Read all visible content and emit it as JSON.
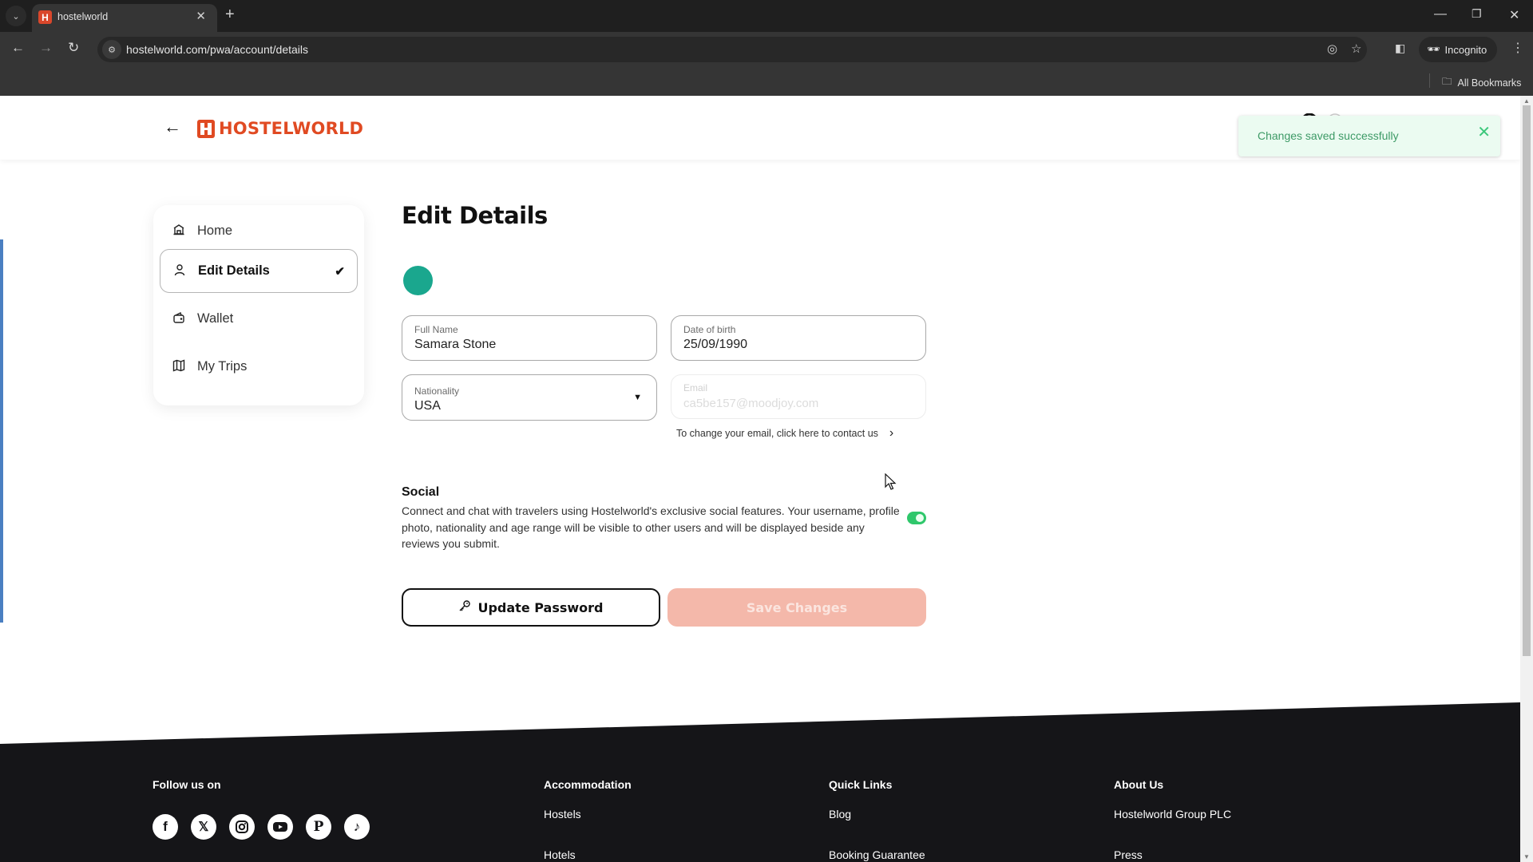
{
  "browser": {
    "tab_title": "hostelworld",
    "url": "hostelworld.com/pwa/account/details",
    "profile_label": "Incognito",
    "bookmarks_label": "All Bookmarks",
    "icons": {
      "tab_list": "chevron-down",
      "favicon": "H",
      "tab_close": "✕",
      "new_tab": "+",
      "back": "←",
      "forward": "→",
      "reload": "↻",
      "minimize": "—",
      "restore": "❐",
      "close": "✕"
    }
  },
  "header": {
    "back_icon": "←",
    "logo_text": "HOSTELWORLD"
  },
  "toast": {
    "message": "Changes saved successfully",
    "close_icon": "✕"
  },
  "sidebar": {
    "items": [
      {
        "label": "Home",
        "icon": "home-icon",
        "active": false
      },
      {
        "label": "Edit Details",
        "icon": "user-icon",
        "active": true
      },
      {
        "label": "Wallet",
        "icon": "wallet-icon",
        "active": false
      },
      {
        "label": "My Trips",
        "icon": "map-icon",
        "active": false
      }
    ],
    "check_icon": "✔"
  },
  "main": {
    "title": "Edit Details",
    "avatar_color": "#1aa78e",
    "fields": {
      "full_name": {
        "label": "Full Name",
        "value": "Samara Stone"
      },
      "dob": {
        "label": "Date of birth",
        "value": "25/09/1990"
      },
      "nationality": {
        "label": "Nationality",
        "value": "USA"
      },
      "email": {
        "label": "Email",
        "value": "ca5be157@moodjoy.com",
        "disabled": true
      }
    },
    "contact_text": "To change your email, click here to contact us",
    "social": {
      "title": "Social",
      "description": "Connect and chat with travelers using Hostelworld's exclusive social features. Your username, profile photo, nationality and age range will be visible to other users and will be displayed beside any reviews you submit.",
      "enabled": true
    },
    "buttons": {
      "update_password": "Update Password",
      "save_changes": "Save Changes"
    }
  },
  "footer": {
    "follow_label": "Follow us on",
    "social_networks": [
      "Facebook",
      "X",
      "Instagram",
      "YouTube",
      "Pinterest",
      "TikTok"
    ],
    "columns": [
      {
        "heading": "Accommodation",
        "links": [
          "Hostels",
          "Hotels"
        ]
      },
      {
        "heading": "Quick Links",
        "links": [
          "Blog",
          "Booking Guarantee"
        ]
      },
      {
        "heading": "About Us",
        "links": [
          "Hostelworld Group PLC",
          "Press"
        ]
      }
    ]
  },
  "colors": {
    "brand": "#e04a22",
    "toast_bg": "#ebfbf1",
    "toast_text": "#3d9a66",
    "toggle_on": "#2fc76b",
    "save_disabled": "#f4b8aa",
    "footer_bg": "#151518"
  }
}
